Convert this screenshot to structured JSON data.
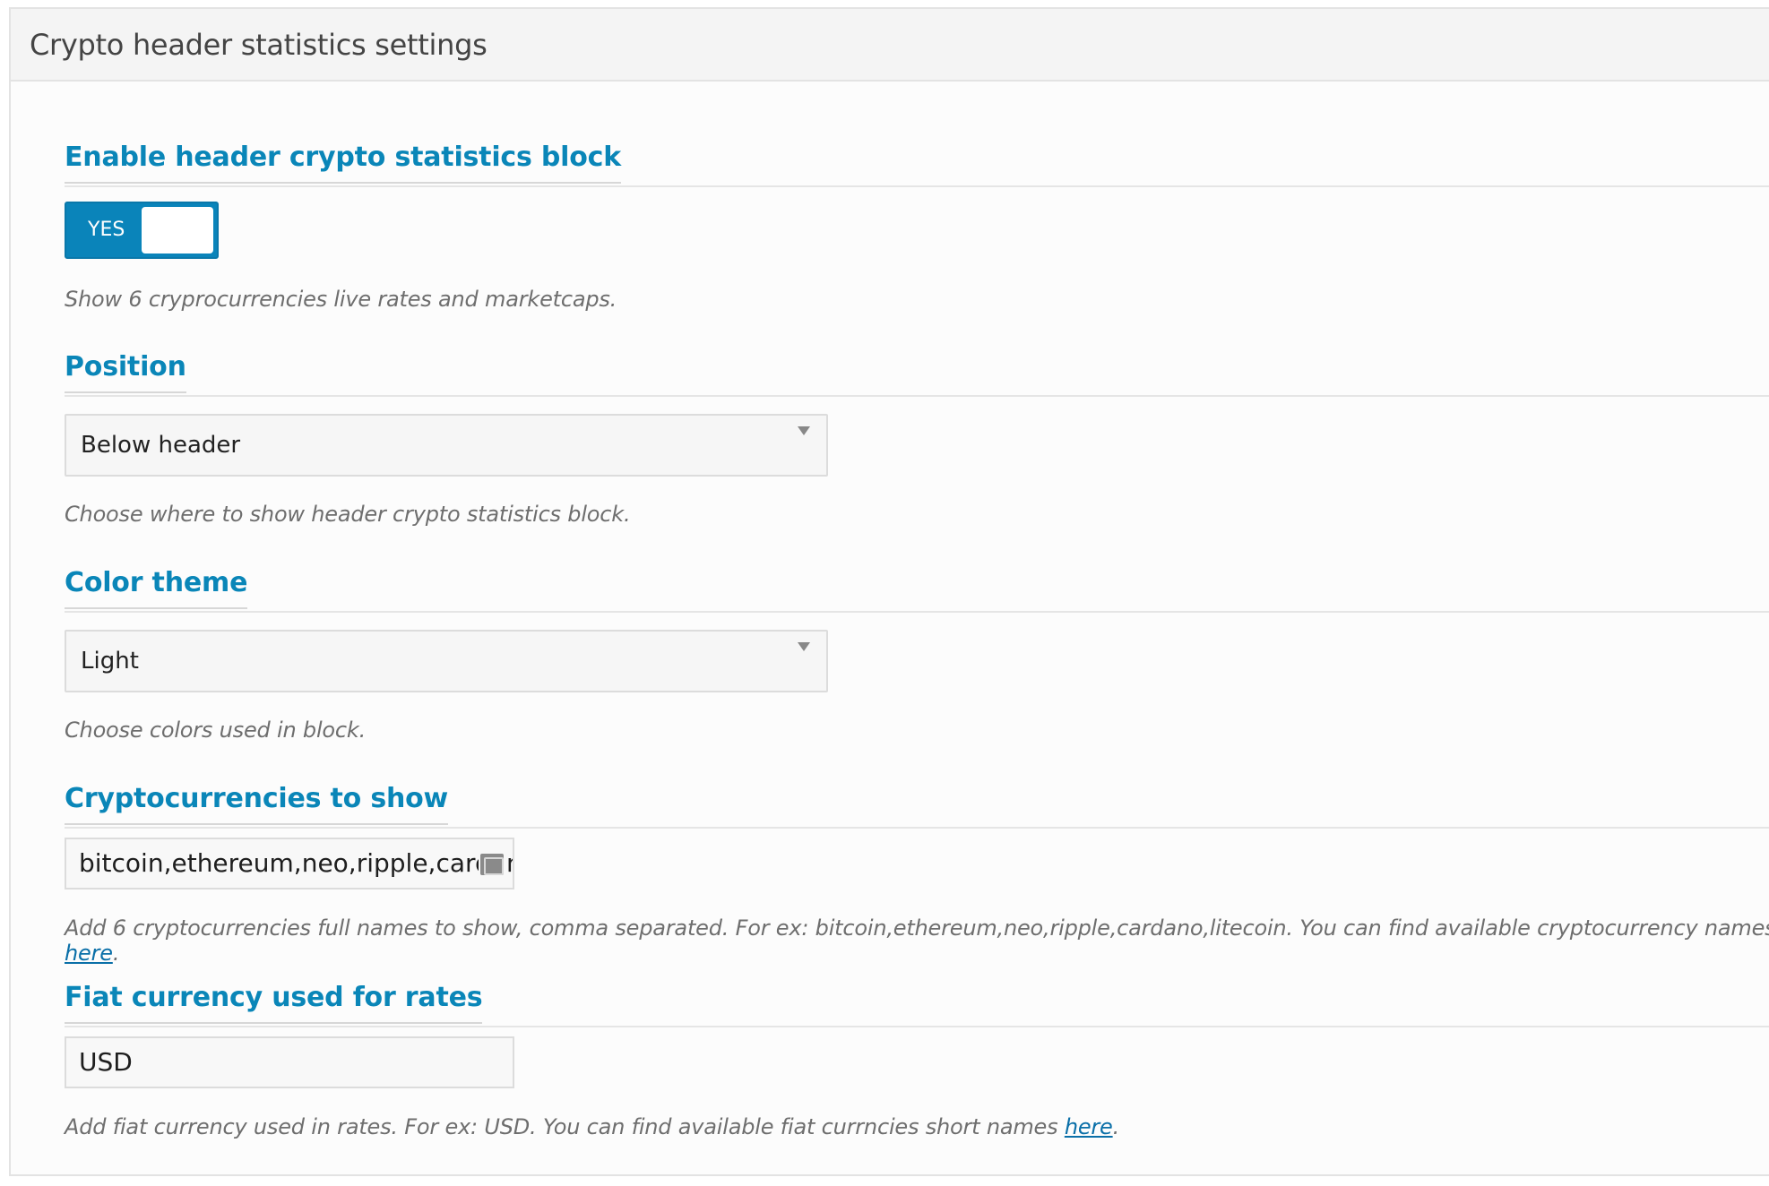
{
  "panel": {
    "title": "Crypto header statistics settings"
  },
  "sections": {
    "enable": {
      "title": "Enable header crypto statistics block",
      "toggle_label": "YES",
      "toggle_state": "on",
      "description": "Show 6 cryprocurrencies live rates and marketcaps."
    },
    "position": {
      "title": "Position",
      "selected": "Below header",
      "description": "Choose where to show header crypto statistics block."
    },
    "color_theme": {
      "title": "Color theme",
      "selected": "Light",
      "description": "Choose colors used in block."
    },
    "cryptocurrencies": {
      "title": "Cryptocurrencies to show",
      "value": "bitcoin,ethereum,neo,ripple,cardano,litecoin",
      "description": "Add 6 cryptocurrencies full names to show, comma separated. For ex: bitcoin,ethereum,neo,ripple,cardano,litecoin. You can find available cryptocurrency names ",
      "link_text": "here",
      "description_end": "."
    },
    "fiat": {
      "title": "Fiat currency used for rates",
      "value": "USD",
      "description": "Add fiat currency used in rates. For ex: USD. You can find available fiat currncies short names ",
      "link_text": "here",
      "description_end": "."
    }
  },
  "icons": {
    "select_arrow": "caret-down-icon",
    "input_icon": "contact-card-icon"
  },
  "colors": {
    "accent": "#0a84ba",
    "heading": "#0a86b8",
    "description": "#6e6e6e"
  }
}
